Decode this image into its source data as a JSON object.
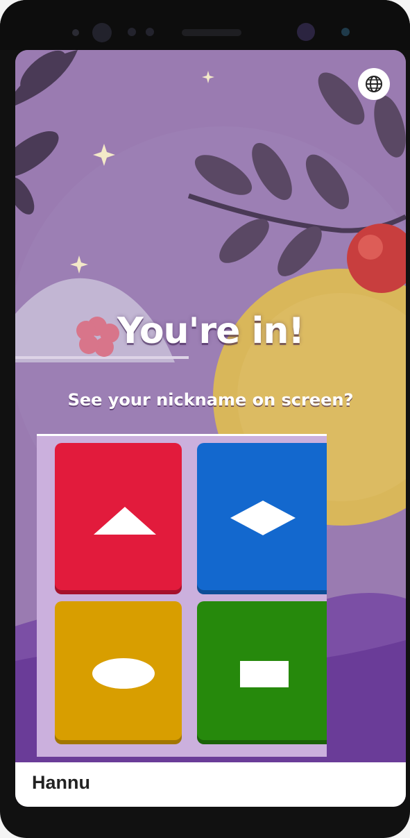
{
  "status": {
    "title": "You're in!",
    "subtitle": "See your nickname on screen?"
  },
  "header": {
    "language_icon": "globe-icon"
  },
  "answers": [
    {
      "color": "#e21b3c",
      "shape": "triangle"
    },
    {
      "color": "#1368ce",
      "shape": "diamond"
    },
    {
      "color": "#d89e00",
      "shape": "circle"
    },
    {
      "color": "#26890c",
      "shape": "square"
    }
  ],
  "player": {
    "nickname": "Hannu"
  }
}
